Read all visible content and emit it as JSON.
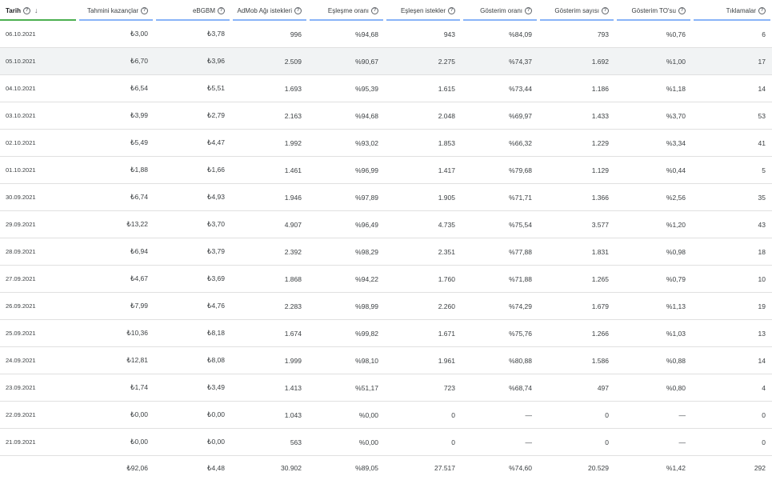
{
  "headers": [
    {
      "label": "Tarih",
      "help": true,
      "sort": "↓"
    },
    {
      "label": "Tahmini kazançlar",
      "help": true
    },
    {
      "label": "eBGBM",
      "help": true
    },
    {
      "label": "AdMob Ağı istekleri",
      "help": true
    },
    {
      "label": "Eşleşme oranı",
      "help": true
    },
    {
      "label": "Eşleşen istekler",
      "help": true
    },
    {
      "label": "Gösterim oranı",
      "help": true
    },
    {
      "label": "Gösterim sayısı",
      "help": true
    },
    {
      "label": "Gösterim TO'su",
      "help": true
    },
    {
      "label": "Tıklamalar",
      "help": true
    }
  ],
  "rows": [
    [
      "06.10.2021",
      "₺3,00",
      "₺3,78",
      "996",
      "%94,68",
      "943",
      "%84,09",
      "793",
      "%0,76",
      "6"
    ],
    [
      "05.10.2021",
      "₺6,70",
      "₺3,96",
      "2.509",
      "%90,67",
      "2.275",
      "%74,37",
      "1.692",
      "%1,00",
      "17"
    ],
    [
      "04.10.2021",
      "₺6,54",
      "₺5,51",
      "1.693",
      "%95,39",
      "1.615",
      "%73,44",
      "1.186",
      "%1,18",
      "14"
    ],
    [
      "03.10.2021",
      "₺3,99",
      "₺2,79",
      "2.163",
      "%94,68",
      "2.048",
      "%69,97",
      "1.433",
      "%3,70",
      "53"
    ],
    [
      "02.10.2021",
      "₺5,49",
      "₺4,47",
      "1.992",
      "%93,02",
      "1.853",
      "%66,32",
      "1.229",
      "%3,34",
      "41"
    ],
    [
      "01.10.2021",
      "₺1,88",
      "₺1,66",
      "1.461",
      "%96,99",
      "1.417",
      "%79,68",
      "1.129",
      "%0,44",
      "5"
    ],
    [
      "30.09.2021",
      "₺6,74",
      "₺4,93",
      "1.946",
      "%97,89",
      "1.905",
      "%71,71",
      "1.366",
      "%2,56",
      "35"
    ],
    [
      "29.09.2021",
      "₺13,22",
      "₺3,70",
      "4.907",
      "%96,49",
      "4.735",
      "%75,54",
      "3.577",
      "%1,20",
      "43"
    ],
    [
      "28.09.2021",
      "₺6,94",
      "₺3,79",
      "2.392",
      "%98,29",
      "2.351",
      "%77,88",
      "1.831",
      "%0,98",
      "18"
    ],
    [
      "27.09.2021",
      "₺4,67",
      "₺3,69",
      "1.868",
      "%94,22",
      "1.760",
      "%71,88",
      "1.265",
      "%0,79",
      "10"
    ],
    [
      "26.09.2021",
      "₺7,99",
      "₺4,76",
      "2.283",
      "%98,99",
      "2.260",
      "%74,29",
      "1.679",
      "%1,13",
      "19"
    ],
    [
      "25.09.2021",
      "₺10,36",
      "₺8,18",
      "1.674",
      "%99,82",
      "1.671",
      "%75,76",
      "1.266",
      "%1,03",
      "13"
    ],
    [
      "24.09.2021",
      "₺12,81",
      "₺8,08",
      "1.999",
      "%98,10",
      "1.961",
      "%80,88",
      "1.586",
      "%0,88",
      "14"
    ],
    [
      "23.09.2021",
      "₺1,74",
      "₺3,49",
      "1.413",
      "%51,17",
      "723",
      "%68,74",
      "497",
      "%0,80",
      "4"
    ],
    [
      "22.09.2021",
      "₺0,00",
      "₺0,00",
      "1.043",
      "%0,00",
      "0",
      "—",
      "0",
      "—",
      "0"
    ],
    [
      "21.09.2021",
      "₺0,00",
      "₺0,00",
      "563",
      "%0,00",
      "0",
      "—",
      "0",
      "—",
      "0"
    ]
  ],
  "highlighted_row_index": 1,
  "totals": [
    "",
    "₺92,06",
    "₺4,48",
    "30.902",
    "%89,05",
    "27.517",
    "%74,60",
    "20.529",
    "%1,42",
    "292"
  ],
  "colors": {
    "sorted_column_bar": "#4caf50",
    "column_bar": "#8ab4f8",
    "row_highlight": "#f1f3f4"
  }
}
